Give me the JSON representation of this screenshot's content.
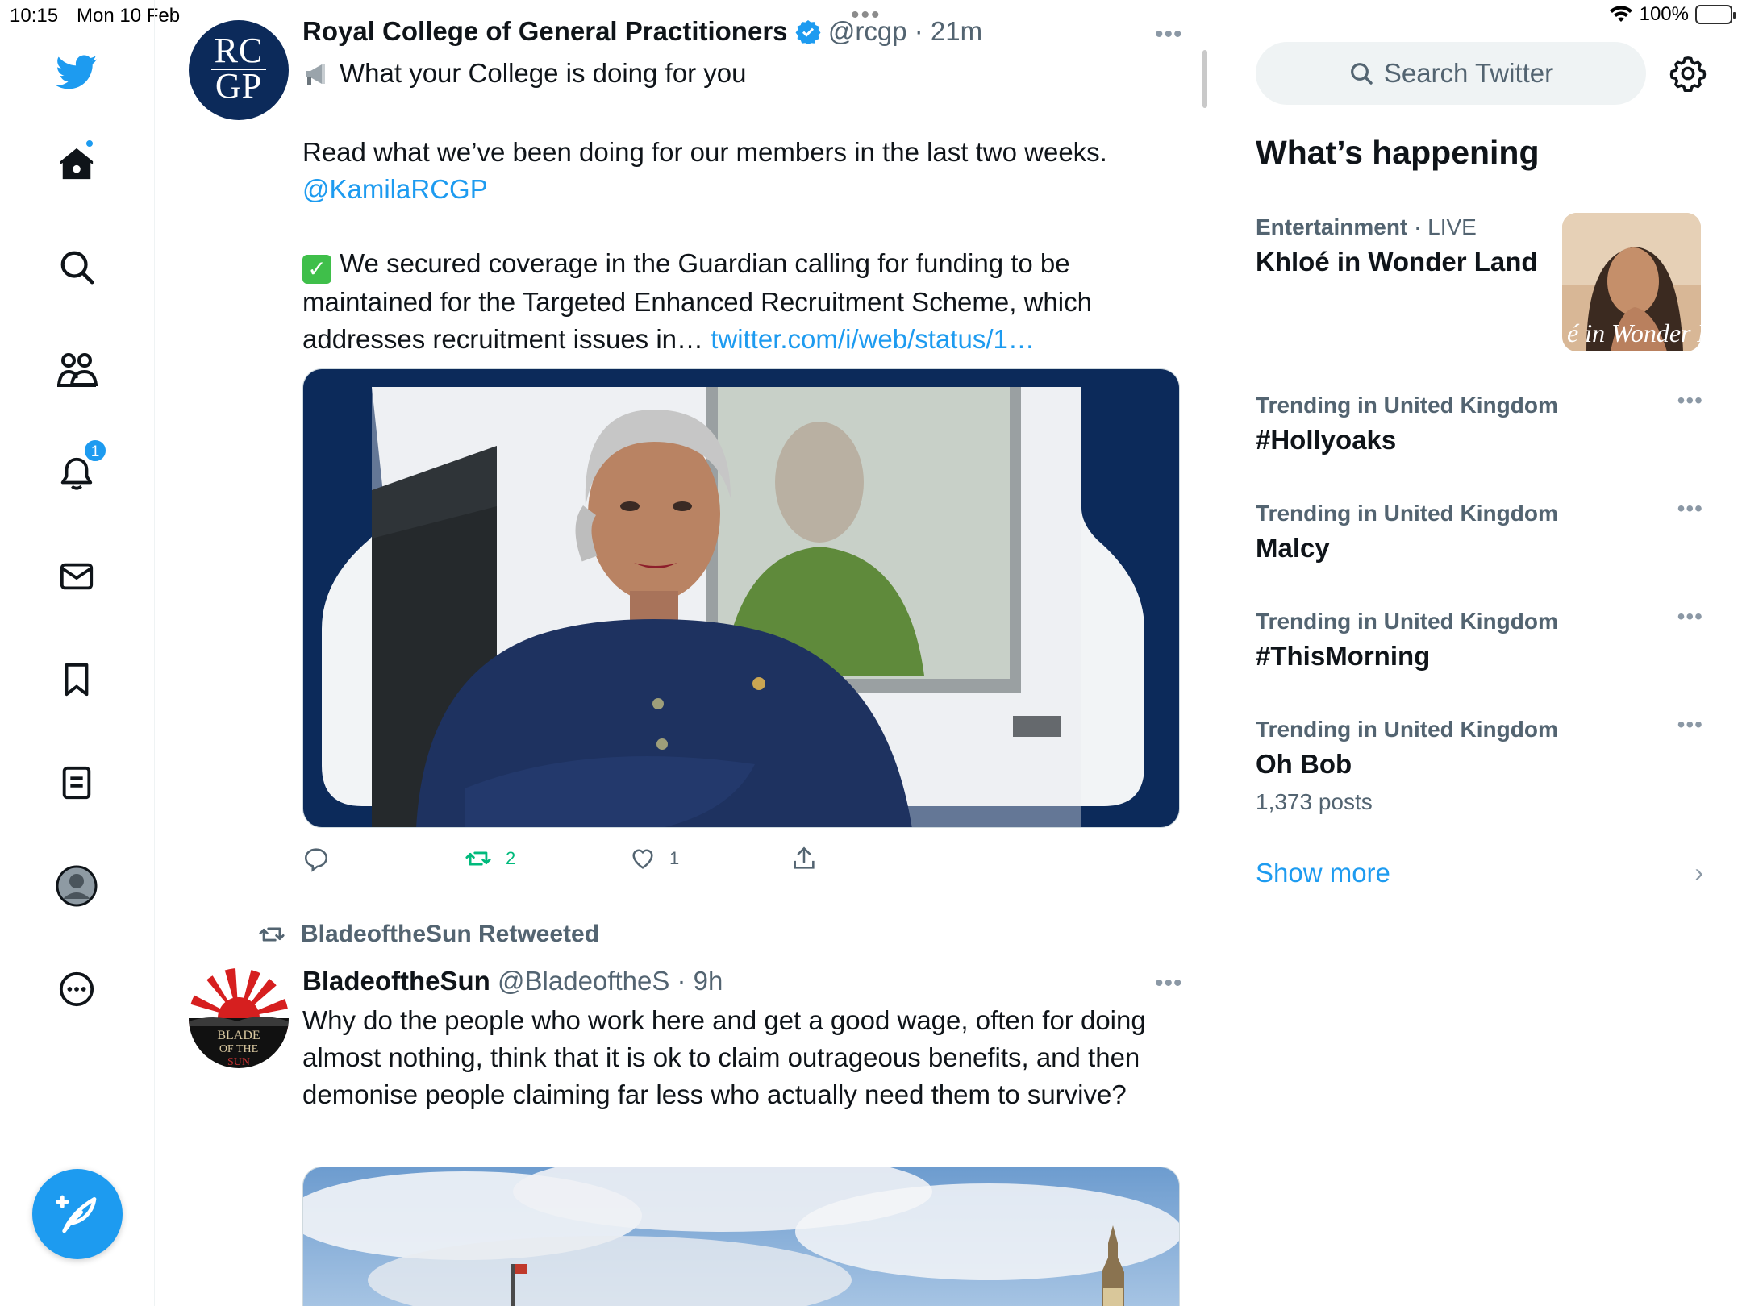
{
  "status_bar": {
    "time": "10:15",
    "date": "Mon 10 Feb",
    "battery": "100%"
  },
  "nav": {
    "notifications_badge": "1"
  },
  "tweets": [
    {
      "author_name": "Royal College of General Practitioners",
      "handle": "@rcgp",
      "time": "· 21m",
      "avatar_line1": "RC",
      "avatar_line2": "GP",
      "text_line1": "What your College is doing for you",
      "text_line2": "Read what we’ve been doing for our members in the last two weeks.",
      "mention": "@KamilaRCGP",
      "text_line3": "We secured coverage in the Guardian calling for funding to be maintained for the Targeted Enhanced Recruitment Scheme, which addresses recruitment issues in…",
      "link": "twitter.com/i/web/status/1…",
      "retweets": "2",
      "likes": "1"
    },
    {
      "retweeted_by": "BladeoftheSun Retweeted",
      "author_name": "BladeoftheSun",
      "handle": "@BladeoftheS",
      "time": "· 9h",
      "avatar_text": "BLADE OF THE SUN",
      "text": "Why do the people who work here and get a good wage, often for doing almost nothing, think that it is ok to claim outrageous benefits, and then demonise people claiming far less who actually need them to survive?"
    }
  ],
  "sidebar": {
    "search_placeholder": "Search Twitter",
    "section_title": "What’s happening",
    "trends": [
      {
        "context": "Entertainment",
        "live": " · LIVE",
        "title": "Khloé in Wonder Land",
        "thumb_text": "é in Wonder L"
      },
      {
        "context": "Trending in United Kingdom",
        "title": "#Hollyoaks"
      },
      {
        "context": "Trending in United Kingdom",
        "title": "Malcy"
      },
      {
        "context": "Trending in United Kingdom",
        "title": "#ThisMorning"
      },
      {
        "context": "Trending in United Kingdom",
        "title": "Oh Bob",
        "count": "1,373 posts"
      }
    ],
    "show_more": "Show more"
  },
  "colors": {
    "accent": "#1d9bf0",
    "retweet": "#00ba7c",
    "secondary_text": "#536471",
    "rcgp_navy": "#0c2a5a"
  },
  "icons": {
    "nav": [
      "twitter-bird-icon",
      "home-icon",
      "explore-icon",
      "communities-icon",
      "notifications-icon",
      "messages-icon",
      "bookmarks-icon",
      "lists-icon",
      "profile-icon",
      "more-icon"
    ],
    "compose": "compose-tweet-icon"
  }
}
